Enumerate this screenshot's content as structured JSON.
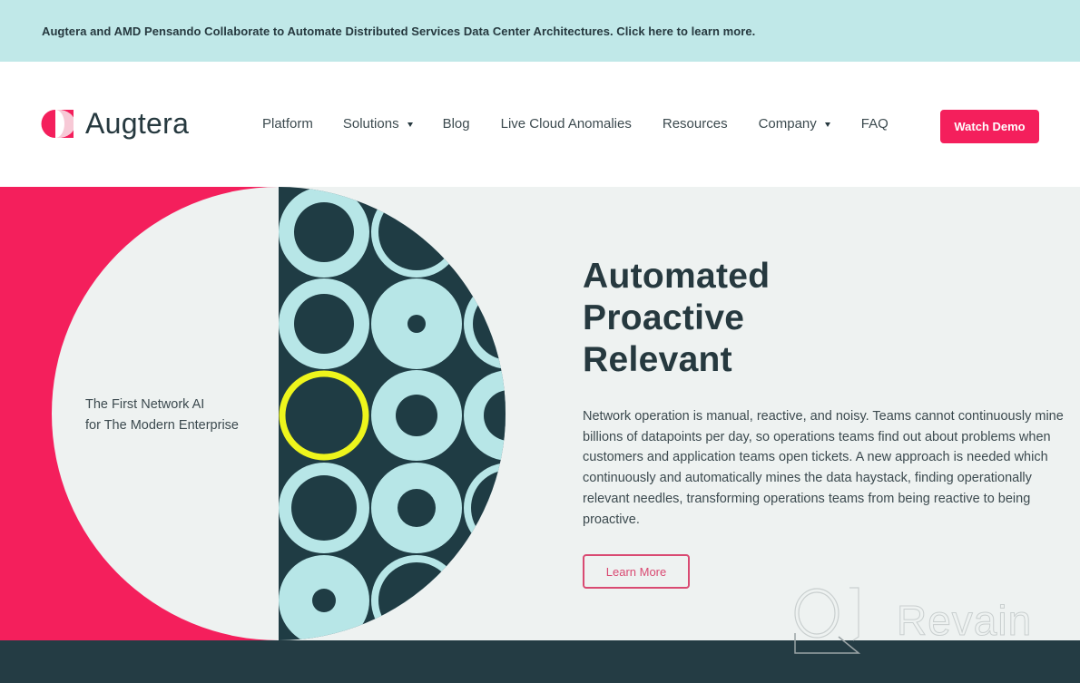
{
  "banner": {
    "text": "Augtera and AMD Pensando Collaborate to Automate Distributed Services Data Center Architectures. Click here to learn more."
  },
  "header": {
    "logo_text": "Augtera",
    "logo_icon": "augtera-logo-mark",
    "nav": [
      {
        "label": "Platform",
        "has_dropdown": false
      },
      {
        "label": "Solutions",
        "has_dropdown": true
      },
      {
        "label": "Blog",
        "has_dropdown": false
      },
      {
        "label": "Live Cloud Anomalies",
        "has_dropdown": false
      },
      {
        "label": "Resources",
        "has_dropdown": false
      },
      {
        "label": "Company",
        "has_dropdown": true
      },
      {
        "label": "FAQ",
        "has_dropdown": false
      }
    ],
    "cta_label": "Watch Demo"
  },
  "hero": {
    "tagline_line1": "The First Network AI",
    "tagline_line2": "for The Modern Enterprise",
    "headline": [
      "Automated",
      "Proactive",
      "Relevant"
    ],
    "body": "Network operation is manual, reactive, and noisy. Teams cannot continuously mine billions of datapoints per day, so operations teams find out about problems when customers and application teams open tickets. A new approach is needed which continuously and automatically mines the data haystack, finding operationally relevant needles, transforming operations teams from being reactive to being proactive.",
    "learn_more_label": "Learn More"
  },
  "watermark": {
    "text": "Revain",
    "icon": "revain-logo-icon"
  },
  "colors": {
    "brand_pink": "#f41f5c",
    "dark_teal": "#1f3c44",
    "light_cyan": "#b7e6e7",
    "highlight_yellow": "#eef51c",
    "banner_bg": "#c0e8e8",
    "hero_bg": "#eef2f1"
  }
}
